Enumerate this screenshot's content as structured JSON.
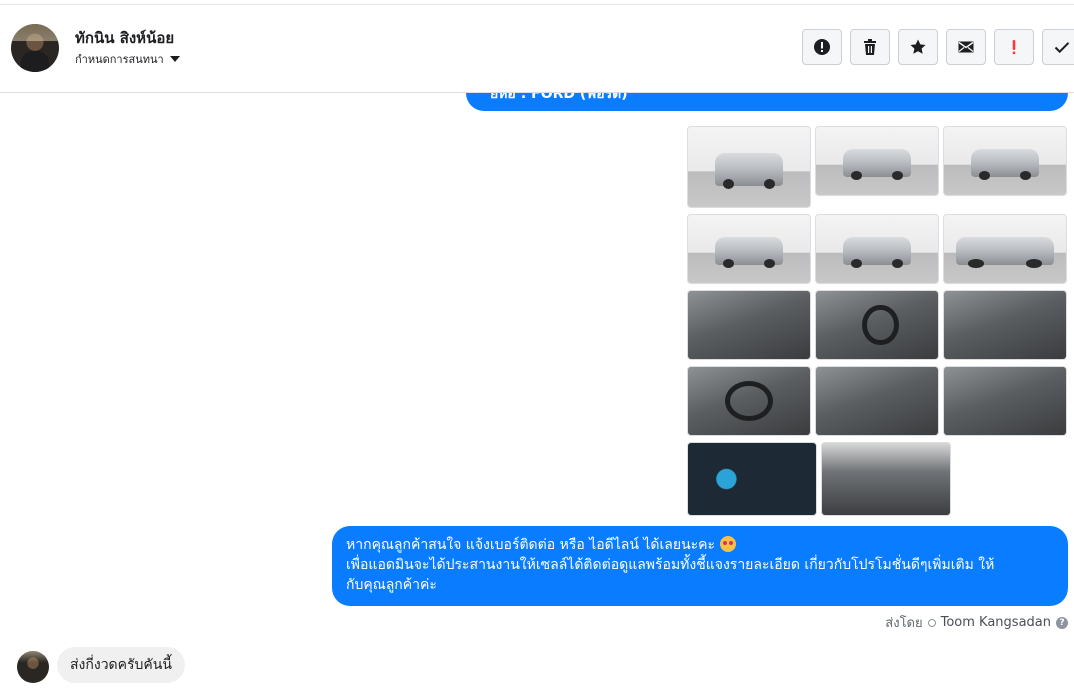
{
  "header": {
    "contact_name": "ทักนิน สิงห์น้อย",
    "assign_label": "กำหนดการสนทนา",
    "actions": [
      {
        "icon": "alert-circle-icon",
        "color": "#1c1e21"
      },
      {
        "icon": "trash-icon",
        "color": "#1c1e21"
      },
      {
        "icon": "star-icon",
        "color": "#1c1e21"
      },
      {
        "icon": "envelope-icon",
        "color": "#1c1e21"
      },
      {
        "icon": "exclamation-icon",
        "color": "#fa383e"
      },
      {
        "icon": "checkmark-icon",
        "color": "#1c1e21"
      }
    ]
  },
  "messages": {
    "top_partial_text": "ยี่ห้อ : FORD (ฟอร์ด)",
    "photo_count": 14,
    "outgoing_line1": "หากคุณลูกค้าสนใจ แจ้งเบอร์ติดต่อ หรือ ไอดีไลน์ ได้เลยนะคะ",
    "outgoing_line2": "เพื่อแอดมินจะได้ประสานงานให้เซลล์ได้ติดต่อดูแลพร้อมทั้งชี้แจงรายละเอียด เกี่ยวกับโปรโมชั่นดีๆเพิ่มเติม ให้",
    "outgoing_line3": "กับคุณลูกค้าค่ะ",
    "sent_by_label": "ส่งโดย",
    "sent_by_name": "Toom Kangsadan",
    "incoming_text": "ส่งกี่งวดครับคันนี้"
  },
  "colors": {
    "outgoing_bubble": "#0a7cff",
    "incoming_bubble": "#f1f0f0",
    "danger": "#fa383e"
  }
}
